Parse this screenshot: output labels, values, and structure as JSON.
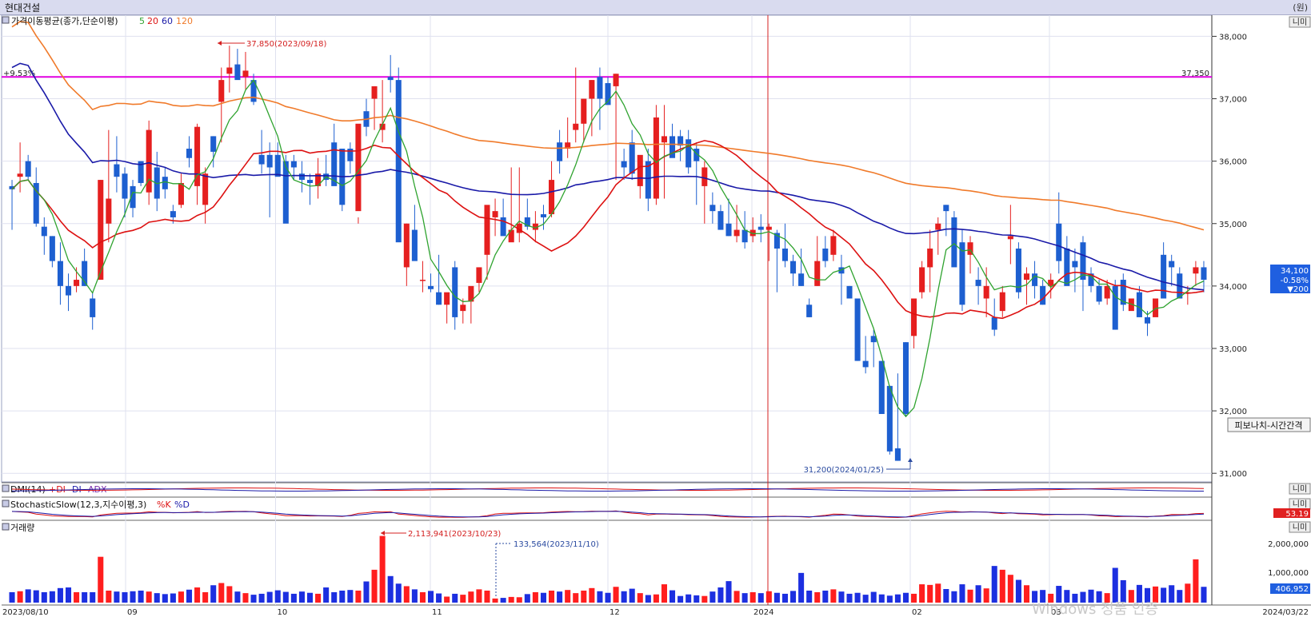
{
  "window": {
    "title": "현대건설",
    "unit": "(원)"
  },
  "main_panel": {
    "legend_title": "가격이동평균(종가,단순이평)",
    "ma_labels": [
      {
        "text": "5",
        "color": "#2fa32f"
      },
      {
        "text": "20",
        "color": "#dd1111"
      },
      {
        "text": "60",
        "color": "#1a1aa8"
      },
      {
        "text": "120",
        "color": "#f07a2a"
      }
    ],
    "hline_left": "+9.53%",
    "hline_right": "37,350",
    "hline_color": "#e000e0",
    "high_annotation": "37,850(2023/09/18)",
    "low_annotation": "31,200(2024/01/25)",
    "last_price": "34,100",
    "last_change_pct": "-0.58%",
    "last_change": "▼200",
    "fib_button": "피보나치-시간간격"
  },
  "y_axis_ticks": [
    "38,000",
    "37,000",
    "36,000",
    "35,000",
    "34,000",
    "33,000",
    "32,000",
    "31,000"
  ],
  "x_axis": {
    "start_date": "2023/08/10",
    "end_date": "2024/03/22",
    "month_labels": [
      "09",
      "10",
      "11",
      "12",
      "2024",
      "02",
      "03"
    ]
  },
  "dmi_panel": {
    "title": "DMI(14)",
    "pdi": "+DI",
    "mdi": "-DI",
    "adx": "ADX"
  },
  "stoch_panel": {
    "title": "StochasticSlow(12,3,지수이평,3)",
    "k": "%K",
    "d": "%D",
    "last_k": "53.19"
  },
  "volume_panel": {
    "title": "거래량",
    "max_annotation": "2,113,941(2023/10/23)",
    "annotation2": "133,564(2023/11/10)",
    "ticks": [
      "2,000,000",
      "1,000,000"
    ],
    "last_volume": "406,952"
  },
  "panel_controls": "니미",
  "watermark": "Windows 정품 인증",
  "chart_data": {
    "type": "candlestick",
    "title": "현대건설",
    "period": [
      "2023/08/10",
      "2024/03/22"
    ],
    "ylim": [
      30900,
      38300
    ],
    "candles": [
      [
        35600,
        35700,
        34900,
        35550
      ],
      [
        35750,
        36300,
        35500,
        35800
      ],
      [
        36000,
        36100,
        35700,
        35750
      ],
      [
        35650,
        35900,
        34950,
        35000
      ],
      [
        34950,
        35100,
        34500,
        34800
      ],
      [
        34800,
        34800,
        34300,
        34400
      ],
      [
        34400,
        34700,
        33700,
        34000
      ],
      [
        34000,
        34200,
        33600,
        33850
      ],
      [
        34000,
        34300,
        33900,
        34100
      ],
      [
        34400,
        34600,
        34000,
        34000
      ],
      [
        33800,
        33900,
        33300,
        33500
      ],
      [
        34100,
        35700,
        34100,
        35700
      ],
      [
        35000,
        36500,
        34700,
        35400
      ],
      [
        35950,
        36400,
        35500,
        35750
      ],
      [
        35800,
        35900,
        35100,
        35400
      ],
      [
        35600,
        35700,
        35100,
        35250
      ],
      [
        36000,
        36000,
        35600,
        35650
      ],
      [
        35500,
        36650,
        35300,
        36500
      ],
      [
        35900,
        36150,
        35200,
        35400
      ],
      [
        35750,
        35900,
        35400,
        35550
      ],
      [
        35200,
        35300,
        35000,
        35100
      ],
      [
        35300,
        35800,
        35250,
        35650
      ],
      [
        36200,
        36400,
        35900,
        36050
      ],
      [
        35600,
        36600,
        35300,
        36550
      ],
      [
        35300,
        35900,
        35000,
        35800
      ],
      [
        36400,
        36400,
        35900,
        36150
      ],
      [
        36950,
        37500,
        36300,
        37300
      ],
      [
        37400,
        37850,
        37100,
        37500
      ],
      [
        37550,
        37800,
        37400,
        37300
      ],
      [
        37350,
        37750,
        37150,
        37450
      ],
      [
        37300,
        37400,
        36900,
        36950
      ],
      [
        36100,
        36500,
        35800,
        35950
      ],
      [
        36100,
        36300,
        35100,
        35900
      ],
      [
        36100,
        36300,
        35800,
        35750
      ],
      [
        36000,
        36100,
        35100,
        35000
      ],
      [
        36000,
        36100,
        35700,
        35900
      ],
      [
        35800,
        36000,
        35500,
        35700
      ],
      [
        35700,
        35800,
        35300,
        35650
      ],
      [
        35600,
        36050,
        35400,
        35800
      ],
      [
        35800,
        36100,
        35600,
        35700
      ],
      [
        36300,
        36600,
        35700,
        35600
      ],
      [
        36200,
        36200,
        35200,
        35300
      ],
      [
        36200,
        36300,
        35800,
        36000
      ],
      [
        35200,
        35100,
        35000,
        36600
      ],
      [
        36800,
        37000,
        36400,
        36550
      ],
      [
        37000,
        37200,
        36500,
        37200
      ],
      [
        36500,
        37300,
        36300,
        36600
      ],
      [
        37350,
        37700,
        37100,
        37300
      ],
      [
        37300,
        37500,
        35100,
        34700
      ],
      [
        34300,
        35000,
        34000,
        35000
      ],
      [
        34900,
        35300,
        34700,
        34400
      ],
      [
        34100,
        34400,
        33900,
        34100
      ],
      [
        34000,
        34200,
        33900,
        33950
      ],
      [
        33900,
        34500,
        33700,
        33700
      ],
      [
        33700,
        33800,
        33400,
        33900
      ],
      [
        34300,
        34400,
        33300,
        33500
      ],
      [
        33600,
        33800,
        33400,
        33700
      ],
      [
        33750,
        33900,
        33400,
        34000
      ],
      [
        34050,
        34300,
        33900,
        34300
      ],
      [
        34500,
        34900,
        34100,
        35300
      ],
      [
        35100,
        35400,
        34800,
        35200
      ],
      [
        35100,
        35400,
        34900,
        34800
      ],
      [
        34700,
        35900,
        34800,
        34900
      ],
      [
        34850,
        35900,
        34700,
        35000
      ],
      [
        35100,
        35400,
        34900,
        34950
      ],
      [
        34900,
        35200,
        34700,
        35000
      ],
      [
        35150,
        35300,
        34900,
        35100
      ],
      [
        35150,
        36000,
        35100,
        35700
      ],
      [
        36300,
        36500,
        35800,
        36000
      ],
      [
        36200,
        36700,
        36050,
        36300
      ],
      [
        36500,
        37500,
        36300,
        36600
      ],
      [
        36600,
        37000,
        36300,
        37000
      ],
      [
        37000,
        37300,
        36400,
        37300
      ],
      [
        37350,
        37500,
        36500,
        37000
      ],
      [
        37250,
        37350,
        37050,
        36900
      ],
      [
        37200,
        37400,
        35700,
        37400
      ],
      [
        36000,
        36200,
        35700,
        35900
      ],
      [
        36300,
        36500,
        35700,
        35800
      ],
      [
        35600,
        35900,
        35400,
        36100
      ],
      [
        36000,
        36200,
        35200,
        35400
      ],
      [
        35400,
        36900,
        35300,
        36700
      ],
      [
        36300,
        36900,
        35400,
        36400
      ],
      [
        36400,
        36600,
        36100,
        36050
      ],
      [
        36400,
        36500,
        36000,
        36250
      ],
      [
        36350,
        36500,
        35800,
        35900
      ],
      [
        36200,
        36300,
        35300,
        36000
      ],
      [
        35600,
        36000,
        35000,
        35900
      ],
      [
        35300,
        35500,
        35000,
        35200
      ],
      [
        35200,
        35300,
        34900,
        34900
      ],
      [
        35000,
        35400,
        34800,
        34800
      ],
      [
        34800,
        35300,
        34700,
        34900
      ],
      [
        34900,
        35200,
        34600,
        34700
      ],
      [
        34800,
        35100,
        34700,
        34900
      ],
      [
        34950,
        35150,
        34700,
        34900
      ],
      [
        34900,
        35000,
        34400,
        34950
      ],
      [
        34850,
        34900,
        33900,
        34600
      ],
      [
        34600,
        35000,
        34300,
        34400
      ],
      [
        34400,
        34500,
        34000,
        34200
      ],
      [
        34200,
        34600,
        34000,
        34000
      ],
      [
        33700,
        33800,
        33500,
        33500
      ],
      [
        34000,
        34800,
        34000,
        34400
      ],
      [
        34600,
        34800,
        34300,
        34400
      ],
      [
        34500,
        34900,
        34400,
        34800
      ],
      [
        34300,
        34500,
        33700,
        34200
      ],
      [
        34000,
        34000,
        33800,
        33800
      ],
      [
        33800,
        33800,
        32800,
        32800
      ],
      [
        32800,
        33200,
        32600,
        32700
      ],
      [
        33200,
        33300,
        32700,
        33100
      ],
      [
        32800,
        32800,
        32000,
        31950
      ],
      [
        32400,
        32400,
        31300,
        31350
      ],
      [
        31400,
        32600,
        31200,
        31200
      ],
      [
        33100,
        33100,
        31900,
        31950
      ],
      [
        33200,
        33700,
        33000,
        33800
      ],
      [
        33900,
        34400,
        33800,
        34300
      ],
      [
        34300,
        34900,
        33900,
        34600
      ],
      [
        34900,
        35100,
        34500,
        35000
      ],
      [
        35300,
        35300,
        34800,
        35200
      ],
      [
        35100,
        35200,
        34600,
        34300
      ],
      [
        34700,
        34900,
        33600,
        33700
      ],
      [
        34500,
        34800,
        34200,
        34700
      ],
      [
        34100,
        34300,
        33700,
        34000
      ],
      [
        33800,
        34300,
        33500,
        34000
      ],
      [
        33500,
        33800,
        33200,
        33300
      ],
      [
        33600,
        34000,
        33500,
        33900
      ],
      [
        34750,
        35300,
        34350,
        34800
      ],
      [
        34600,
        34700,
        33800,
        33900
      ],
      [
        34100,
        34300,
        33700,
        34200
      ],
      [
        34200,
        34400,
        33800,
        34000
      ],
      [
        34000,
        34100,
        33700,
        33700
      ],
      [
        34000,
        34200,
        33800,
        34100
      ],
      [
        35000,
        35500,
        34200,
        34400
      ],
      [
        34600,
        34800,
        34200,
        34000
      ],
      [
        34400,
        34600,
        33900,
        34300
      ],
      [
        34700,
        34800,
        33600,
        34100
      ],
      [
        34200,
        34300,
        33900,
        34000
      ],
      [
        34000,
        34100,
        33700,
        33750
      ],
      [
        33800,
        34100,
        33700,
        34000
      ],
      [
        34000,
        34100,
        33300,
        33300
      ],
      [
        34100,
        34200,
        33600,
        33700
      ],
      [
        33600,
        33700,
        33700,
        33800
      ],
      [
        33900,
        34000,
        33500,
        33500
      ],
      [
        33500,
        33600,
        33200,
        33400
      ],
      [
        33500,
        33400,
        33400,
        33800
      ],
      [
        34500,
        34700,
        33800,
        33800
      ],
      [
        34400,
        34500,
        34000,
        34300
      ],
      [
        34200,
        34300,
        33800,
        33800
      ],
      [
        33900,
        34000,
        33700,
        33900
      ],
      [
        34200,
        34400,
        34000,
        34300
      ],
      [
        34300,
        34400,
        33900,
        34100
      ]
    ],
    "volume": [
      0.33,
      0.36,
      0.42,
      0.39,
      0.33,
      0.36,
      0.46,
      0.48,
      0.33,
      0.33,
      0.33,
      1.45,
      0.38,
      0.35,
      0.33,
      0.36,
      0.38,
      0.35,
      0.3,
      0.27,
      0.29,
      0.35,
      0.41,
      0.48,
      0.33,
      0.55,
      0.62,
      0.52,
      0.35,
      0.3,
      0.25,
      0.28,
      0.34,
      0.39,
      0.34,
      0.28,
      0.35,
      0.31,
      0.28,
      0.48,
      0.33,
      0.38,
      0.4,
      0.38,
      0.67,
      1.04,
      2.11,
      0.84,
      0.6,
      0.52,
      0.42,
      0.33,
      0.37,
      0.29,
      0.19,
      0.28,
      0.25,
      0.35,
      0.42,
      0.38,
      0.13,
      0.15,
      0.18,
      0.17,
      0.27,
      0.33,
      0.31,
      0.38,
      0.35,
      0.4,
      0.3,
      0.38,
      0.46,
      0.36,
      0.31,
      0.5,
      0.36,
      0.44,
      0.3,
      0.24,
      0.26,
      0.58,
      0.39,
      0.21,
      0.26,
      0.23,
      0.21,
      0.35,
      0.48,
      0.68,
      0.37,
      0.3,
      0.33,
      0.3,
      0.36,
      0.31,
      0.28,
      0.37,
      0.94,
      0.38,
      0.33,
      0.38,
      0.42,
      0.35,
      0.28,
      0.31,
      0.25,
      0.34,
      0.26,
      0.22,
      0.26,
      0.31,
      0.28,
      0.58,
      0.56,
      0.6,
      0.43,
      0.36,
      0.58,
      0.41,
      0.55,
      0.45,
      1.16,
      1.04,
      0.88,
      0.72,
      0.55,
      0.37,
      0.4,
      0.28,
      0.53,
      0.4,
      0.28,
      0.34,
      0.41,
      0.36,
      0.3,
      1.1,
      0.71,
      0.4,
      0.56,
      0.46,
      0.51,
      0.47,
      0.55,
      0.4,
      0.6,
      1.37,
      0.5,
      0.45,
      0.34,
      0.43,
      0.32,
      0.28,
      0.55,
      0.7,
      0.38,
      0.43,
      0.5,
      0.7,
      0.44,
      0.4,
      0.37,
      0.41
    ]
  }
}
